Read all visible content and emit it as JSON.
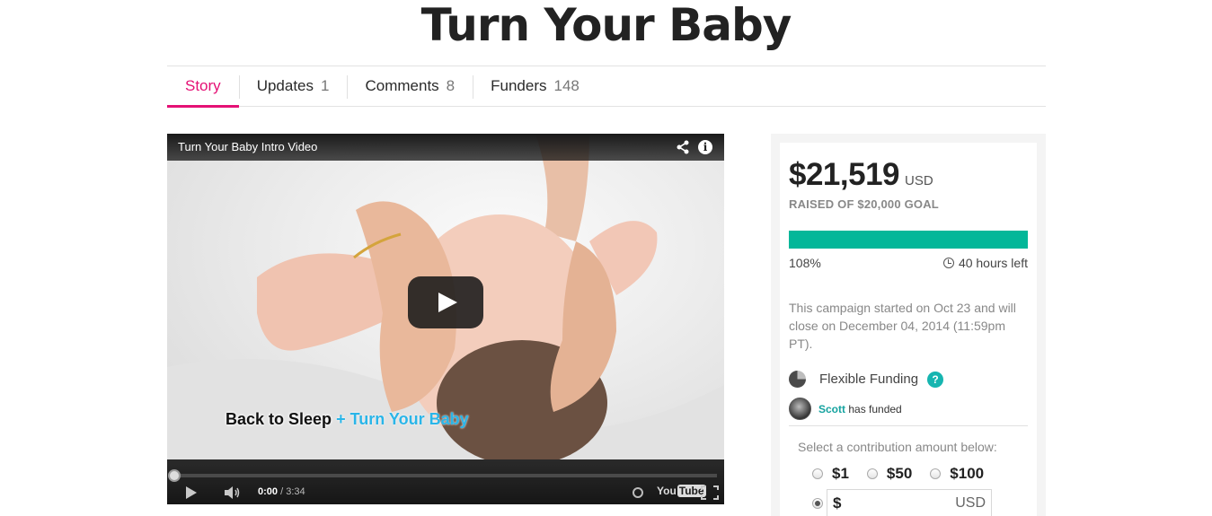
{
  "page": {
    "title": "Turn Your Baby"
  },
  "tabs": [
    {
      "label": "Story",
      "count": ""
    },
    {
      "label": "Updates",
      "count": "1"
    },
    {
      "label": "Comments",
      "count": "8"
    },
    {
      "label": "Funders",
      "count": "148"
    }
  ],
  "video": {
    "title": "Turn Your Baby Intro Video",
    "caption_part1": "Back to Sleep",
    "caption_plus": "+",
    "caption_part2": "Turn Your Baby",
    "time_current": "0:00",
    "time_separator": "/",
    "time_total": "3:34",
    "logo_you": "You",
    "logo_tube": "Tube",
    "progress_fraction": 0,
    "info_glyph": "i"
  },
  "campaign": {
    "raised_amount": "$21,519",
    "currency": "USD",
    "goal_text": "RAISED OF $20,000 GOAL",
    "percent_label": "108%",
    "percent_value": 108,
    "time_left": "40 hours left",
    "note": "This campaign started on Oct 23 and will close on December 04, 2014 (11:59pm PT).",
    "funding_type": "Flexible Funding",
    "help_glyph": "?",
    "funder_name": "Scott",
    "funder_action": "has funded",
    "contribution_heading": "Select a contribution amount below:",
    "amounts": [
      "$1",
      "$50",
      "$100"
    ],
    "custom_prefix": "$",
    "custom_suffix": "USD"
  },
  "colors": {
    "accent_tab": "#e51075",
    "progress_green": "#03b799",
    "teal_link": "#16a3a0"
  }
}
